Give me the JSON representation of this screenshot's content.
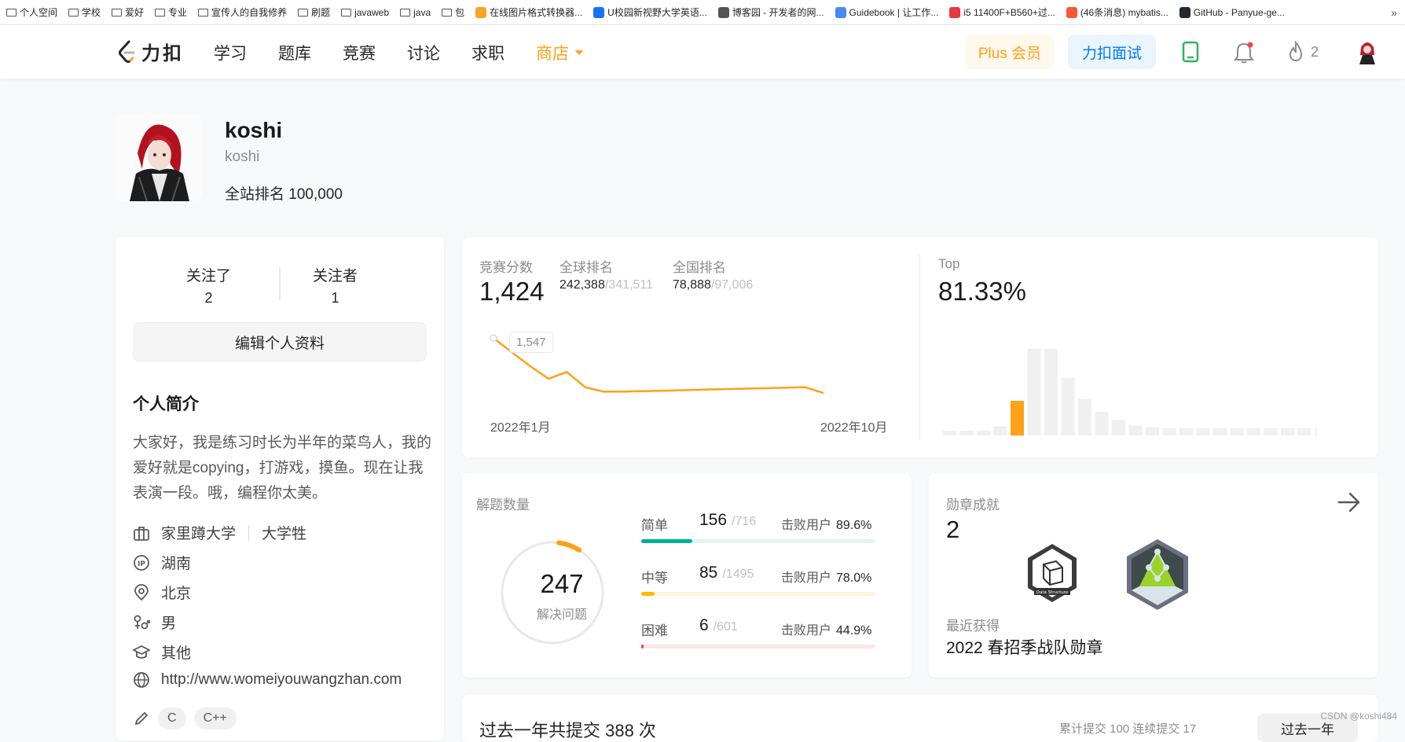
{
  "bookmarks": [
    {
      "label": "个人空间",
      "icon": "folder-icon"
    },
    {
      "label": "学校",
      "icon": "folder-icon"
    },
    {
      "label": "爱好",
      "icon": "folder-icon"
    },
    {
      "label": "专业",
      "icon": "folder-icon"
    },
    {
      "label": "宣传人的自我修养",
      "icon": "folder-icon"
    },
    {
      "label": "刷题",
      "icon": "folder-icon"
    },
    {
      "label": "javaweb",
      "icon": "folder-icon"
    },
    {
      "label": "java",
      "icon": "folder-icon"
    },
    {
      "label": "包",
      "icon": "folder-icon"
    },
    {
      "label": "在线图片格式转换器...",
      "icon": "image-converter-icon",
      "color": "#f5a623"
    },
    {
      "label": "U校园新视野大学英语...",
      "icon": "zhihu-icon",
      "color": "#1772f6"
    },
    {
      "label": "博客园 - 开发者的网...",
      "icon": "cnblogs-icon",
      "color": "#555555"
    },
    {
      "label": "Guidebook | 让工作...",
      "icon": "guidebook-icon",
      "color": "#4a8af4"
    },
    {
      "label": "i5 11400F+B560+过...",
      "icon": "zhihu-z-icon",
      "color": "#e8383d"
    },
    {
      "label": "(46条消息) mybatis...",
      "icon": "csdn-icon",
      "color": "#fc5531"
    },
    {
      "label": "GitHub - Panyue-ge...",
      "icon": "github-icon",
      "color": "#24292e"
    }
  ],
  "nav": {
    "logo": "力扣",
    "links": [
      "学习",
      "题库",
      "竞赛",
      "讨论",
      "求职"
    ],
    "store": "商店",
    "plus": "Plus 会员",
    "interview": "力扣面试",
    "fire_count": "2"
  },
  "profile": {
    "name": "koshi",
    "id": "koshi",
    "rank_label": "全站排名",
    "rank_value": "100,000"
  },
  "follow": {
    "following_label": "关注了",
    "following": "2",
    "followers_label": "关注者",
    "followers": "1"
  },
  "edit_label": "编辑个人资料",
  "bio": {
    "title": "个人简介",
    "text": "大家好，我是练习时长为半年的菜鸟人，我的爱好就是copying，打游戏，摸鱼。现在让我表演一段。哦，编程你太美。"
  },
  "info": {
    "school": "家里蹲大学",
    "role": "大学牲",
    "ip": "湖南",
    "location": "北京",
    "gender": "男",
    "education": "其他",
    "website": "http://www.womeiyouwangzhan.com",
    "skills": [
      "C",
      "C++"
    ]
  },
  "contest": {
    "score_label": "竞赛分数",
    "score": "1,424",
    "global_label": "全球排名",
    "global": "242,388",
    "global_total": "/341,511",
    "national_label": "全国排名",
    "national": "78,888",
    "national_total": "/97,006",
    "top_label": "Top",
    "top": "81.33%",
    "tooltip": "1,547",
    "x_start": "2022年1月",
    "x_end": "2022年10月"
  },
  "chart_data": [
    {
      "type": "line",
      "title": "",
      "x_start": "2022年1月",
      "x_end": "2022年10月",
      "points": [
        1547,
        1515,
        1484,
        1456,
        1471,
        1437,
        1427,
        1427,
        1428,
        1429,
        1430,
        1431,
        1432,
        1433,
        1434,
        1435,
        1436,
        1437,
        1424
      ],
      "highlight_value": 1547,
      "color": "#ffa116"
    },
    {
      "type": "bar",
      "title": "",
      "values": [
        3,
        3,
        3,
        10,
        38,
        95,
        95,
        63,
        40,
        26,
        17,
        11,
        9,
        8,
        8,
        8,
        8,
        8,
        8,
        8,
        8,
        8,
        8
      ],
      "highlight_index": 4,
      "highlight_color": "#ffa116",
      "base_color": "#f0f0f0"
    }
  ],
  "solved": {
    "title": "解题数量",
    "total": "247",
    "total_label": "解决问题",
    "ring_fraction": 0.07,
    "levels": [
      {
        "label": "简单",
        "count": "156",
        "total": "/716",
        "beat_label": "击败用户",
        "beat": "89.6%",
        "fraction": 0.218,
        "color": "#00af9b",
        "track": "#e1f5ef"
      },
      {
        "label": "中等",
        "count": "85",
        "total": "/1495",
        "beat_label": "击败用户",
        "beat": "78.0%",
        "fraction": 0.057,
        "color": "#ffb800",
        "track": "#fff3d9"
      },
      {
        "label": "困难",
        "count": "6",
        "total": "/601",
        "beat_label": "击败用户",
        "beat": "44.9%",
        "fraction": 0.01,
        "color": "#ef4743",
        "track": "#fde6e5"
      }
    ]
  },
  "badges": {
    "title": "勋章成就",
    "count": "2",
    "badge1_text": "Data Structure",
    "recent_label": "最近获得",
    "recent_name": "2022 春招季战队勋章"
  },
  "bottom": {
    "title": "过去一年共提交 388 次",
    "stats": "累计提交 100   连续提交 17",
    "button": "过去一年"
  },
  "watermark": "CSDN @koshi484"
}
